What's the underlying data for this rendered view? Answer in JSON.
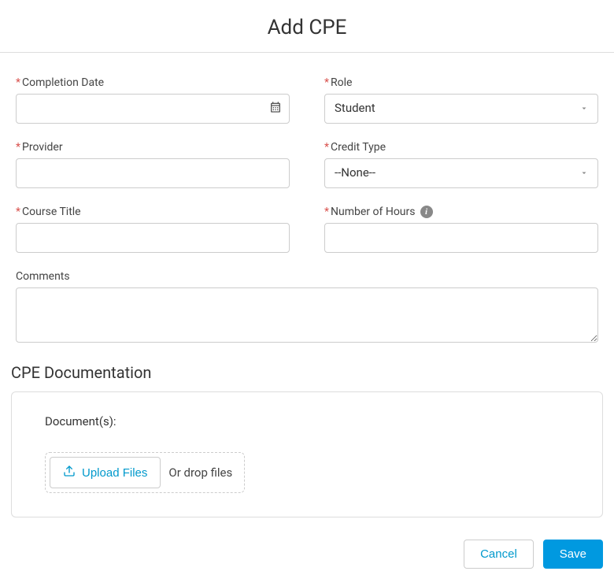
{
  "title": "Add CPE",
  "fields": {
    "completion_date": {
      "label": "Completion Date",
      "value": ""
    },
    "role": {
      "label": "Role",
      "value": "Student"
    },
    "provider": {
      "label": "Provider",
      "value": ""
    },
    "credit_type": {
      "label": "Credit Type",
      "value": "--None--"
    },
    "course_title": {
      "label": "Course Title",
      "value": ""
    },
    "number_of_hours": {
      "label": "Number of Hours",
      "value": ""
    },
    "comments": {
      "label": "Comments",
      "value": ""
    }
  },
  "documentation": {
    "heading": "CPE Documentation",
    "label": "Document(s):",
    "upload_button": "Upload Files",
    "drop_text": "Or drop files"
  },
  "actions": {
    "cancel": "Cancel",
    "save": "Save"
  }
}
